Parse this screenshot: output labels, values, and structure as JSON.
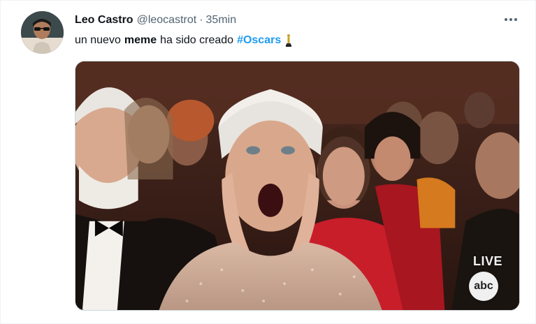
{
  "tweet": {
    "author_name": "Leo Castro",
    "handle": "@leocastrot",
    "separator": "·",
    "time": "35min",
    "text_before": "un nuevo",
    "text_bold": "meme",
    "text_after": "ha sido creado",
    "hashtag": "#Oscars",
    "trophy_icon": "oscar-statuette-emoji",
    "more_icon": "more-options-icon"
  },
  "media": {
    "live_label": "LIVE",
    "network_logo": "abc"
  },
  "colors": {
    "link": "#1d9bf0",
    "secondary_text": "#536471",
    "primary_text": "#0f1419"
  }
}
